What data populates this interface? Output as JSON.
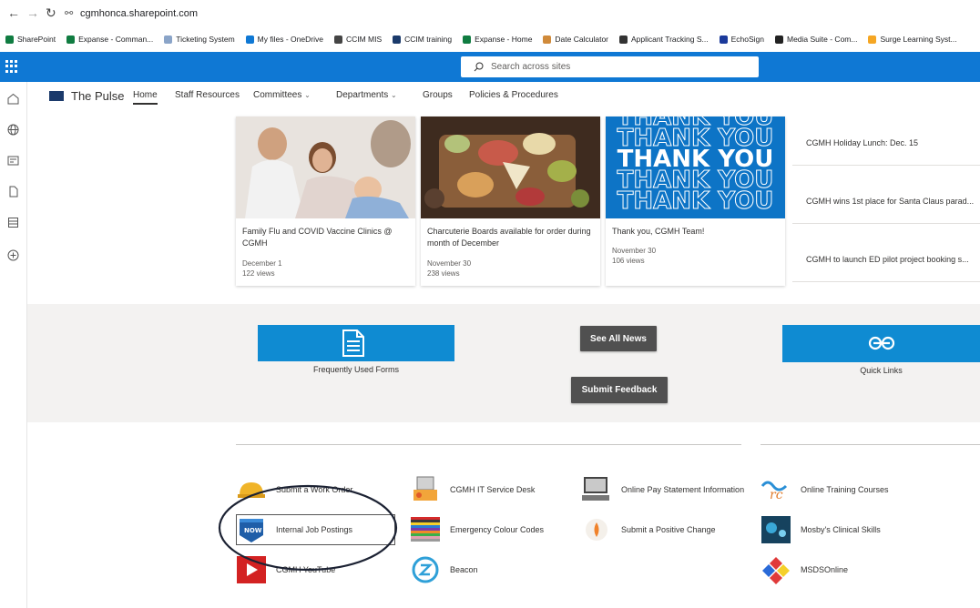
{
  "browser": {
    "url": "cgmhonca.sharepoint.com",
    "bookmarks": [
      {
        "label": "SharePoint",
        "color": "#107c41"
      },
      {
        "label": "Expanse - Comman...",
        "color": "#107c41"
      },
      {
        "label": "Ticketing System",
        "color": "#8aa4c8"
      },
      {
        "label": "My files - OneDrive",
        "color": "#0f78d4"
      },
      {
        "label": "CCIM MIS",
        "color": "#444444"
      },
      {
        "label": "CCIM training",
        "color": "#1b3a6b"
      },
      {
        "label": "Expanse - Home",
        "color": "#107c41"
      },
      {
        "label": "Date Calculator",
        "color": "#d08a3a"
      },
      {
        "label": "Applicant Tracking S...",
        "color": "#333333"
      },
      {
        "label": "EchoSign",
        "color": "#1b3a9b"
      },
      {
        "label": "Media Suite - Com...",
        "color": "#222222"
      },
      {
        "label": "Surge Learning Syst...",
        "color": "#f5a623"
      }
    ]
  },
  "suite": {
    "search_placeholder": "Search across sites",
    "accent": "#0f78d4"
  },
  "site": {
    "title": "The Pulse",
    "nav": [
      "Home",
      "Staff Resources",
      "Committees",
      "Departments",
      "Groups",
      "Policies & Procedures"
    ]
  },
  "news": {
    "cards": [
      {
        "title": "Family Flu and COVID Vaccine Clinics @ CGMH",
        "date": "December 1",
        "views": "122 views",
        "image": "clinic-photo"
      },
      {
        "title": "Charcuterie Boards available for order during month of December",
        "date": "November 30",
        "views": "238 views",
        "image": "charcuterie-photo"
      },
      {
        "title": "Thank you, CGMH Team!",
        "date": "November 30",
        "views": "106 views",
        "image": "thank-you-graphic"
      }
    ],
    "thank_you_text": "THANK YOU",
    "list": [
      "CGMH Holiday Lunch: Dec. 15",
      "CGMH wins 1st place for Santa Claus parad...",
      "CGMH to launch ED pilot project booking s..."
    ]
  },
  "quick": {
    "forms_label": "Frequently Used Forms",
    "links_label": "Quick Links",
    "see_all_news": "See All News",
    "submit_feedback": "Submit Feedback",
    "tile_color": "#0f8bd2"
  },
  "links": [
    {
      "label": "Submit a Work Order",
      "icon": "hard-hat-icon"
    },
    {
      "label": "CGMH IT Service Desk",
      "icon": "it-desk-icon"
    },
    {
      "label": "Online Pay Statement Information",
      "icon": "pay-statement-icon"
    },
    {
      "label": "Online Training Courses",
      "icon": "training-logo-icon"
    },
    {
      "label": "Internal Job Postings",
      "icon": "now-hiring-icon"
    },
    {
      "label": "Emergency Colour Codes",
      "icon": "colour-codes-icon"
    },
    {
      "label": "Submit a Positive Change",
      "icon": "positive-change-icon"
    },
    {
      "label": "Mosby's Clinical Skills",
      "icon": "clinical-skills-icon"
    },
    {
      "label": "CGMH YouTube",
      "icon": "youtube-icon"
    },
    {
      "label": "Beacon",
      "icon": "beacon-icon"
    },
    {
      "label": "MSDSOnline",
      "icon": "msds-icon"
    }
  ]
}
